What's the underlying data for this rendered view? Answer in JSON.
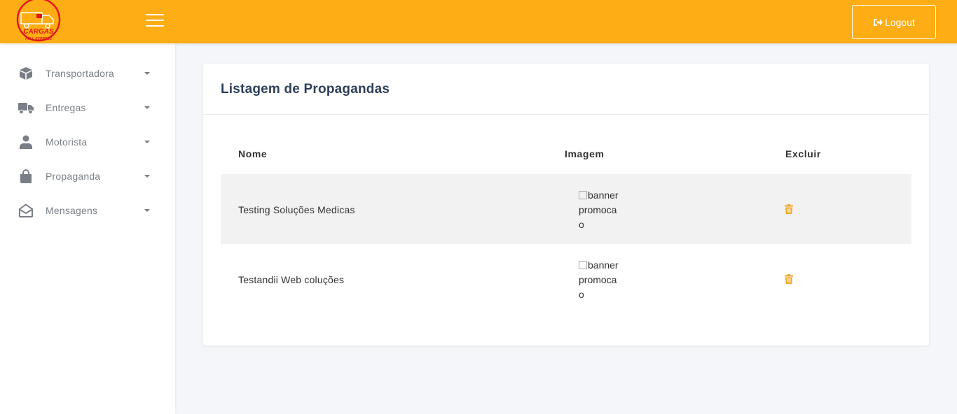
{
  "header": {
    "logo": {
      "text": "CARGAS",
      "subtext": "FULL EXPRESS"
    },
    "menu_icon": "hamburger-icon",
    "logout_label": "Logout",
    "logout_icon": "sign-out-icon",
    "bar_color": "#ffad15"
  },
  "sidebar": {
    "items": [
      {
        "label": "Transportadora",
        "icon": "box-icon"
      },
      {
        "label": "Entregas",
        "icon": "truck-icon"
      },
      {
        "label": "Motorista",
        "icon": "user-icon"
      },
      {
        "label": "Propaganda",
        "icon": "shopping-bag-icon"
      },
      {
        "label": "Mensagens",
        "icon": "envelope-open-icon"
      }
    ]
  },
  "main": {
    "title": "Listagem de Propagandas",
    "table": {
      "headers": [
        "Nome",
        "Imagem",
        "Excluir"
      ],
      "rows": [
        {
          "nome": "Testing Soluções Medicas",
          "imagem_alt": "banner promocao",
          "action_icon": "trash-icon"
        },
        {
          "nome": "Testandii Web coluções",
          "imagem_alt": "banner promocao",
          "action_icon": "trash-icon"
        }
      ]
    },
    "accent_color": "#f5a623"
  }
}
